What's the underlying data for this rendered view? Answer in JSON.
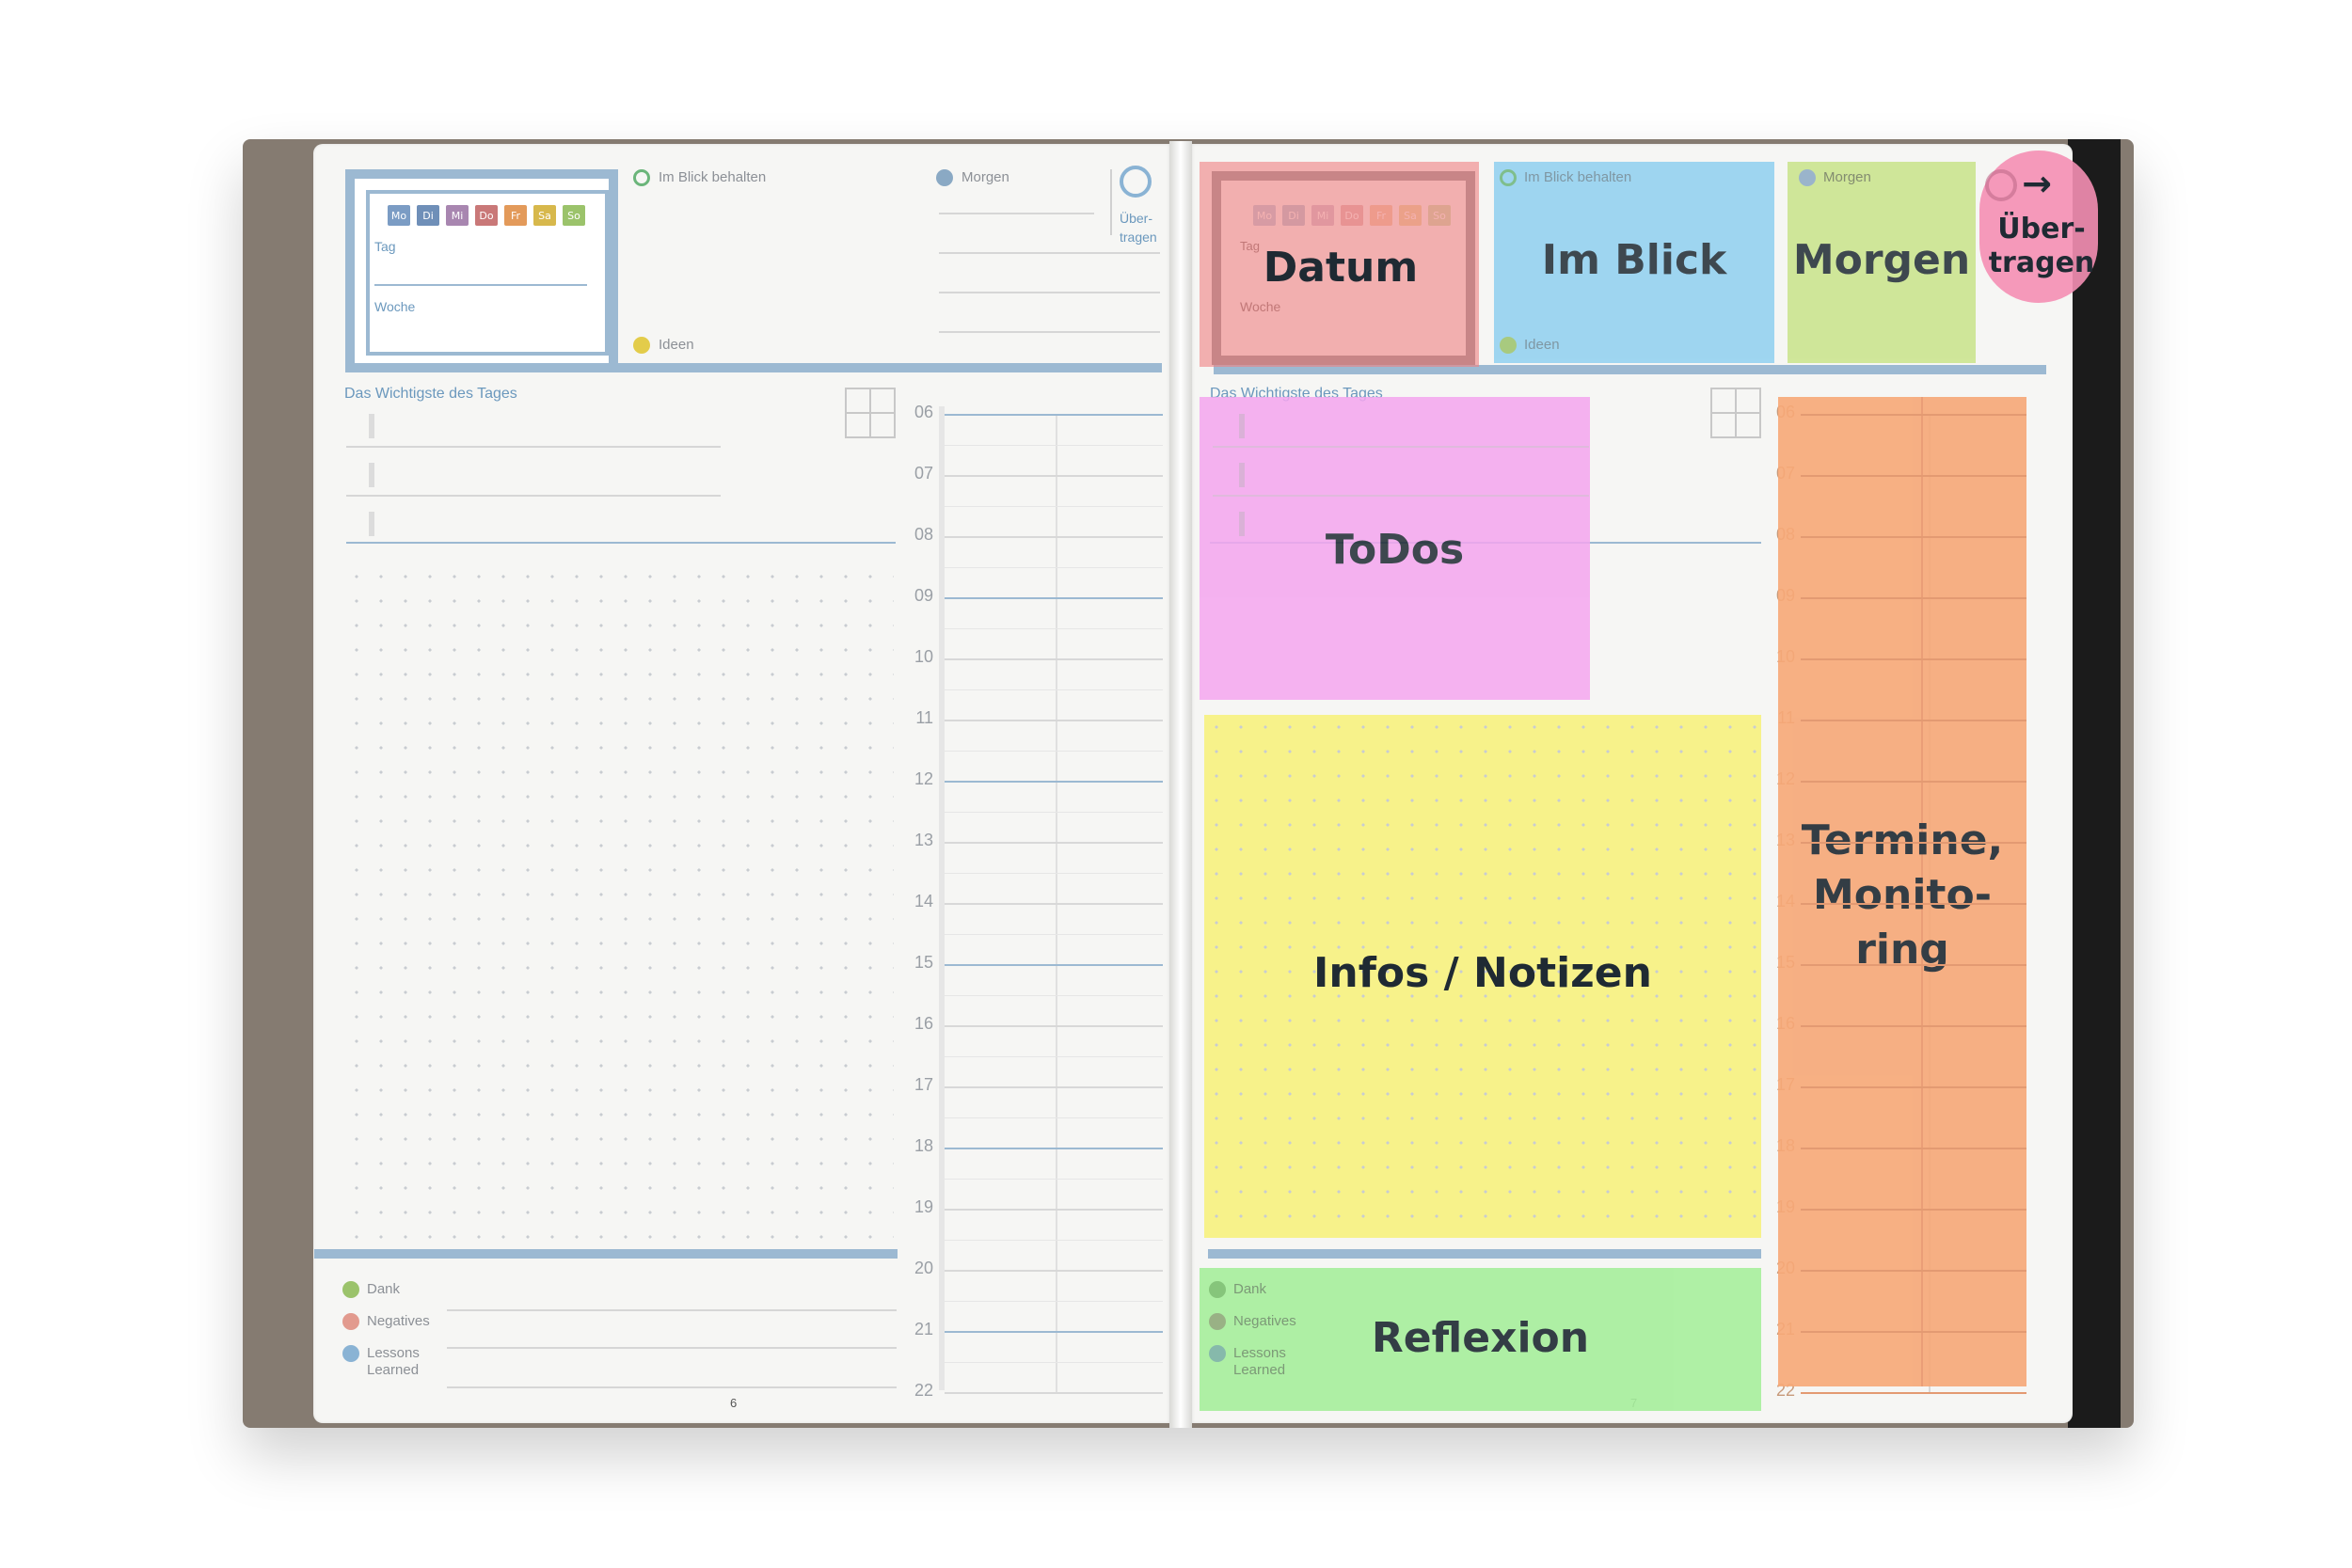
{
  "planner": {
    "days": [
      "Mo",
      "Di",
      "Mi",
      "Do",
      "Fr",
      "Sa",
      "So"
    ],
    "day_colors": [
      "#7b9cc4",
      "#6f8fb8",
      "#a886b0",
      "#c97878",
      "#e39a5a",
      "#d7b84c",
      "#9bc36b"
    ],
    "tag_label": "Tag",
    "woche_label": "Woche",
    "im_blick_label": "Im Blick behalten",
    "morgen_label": "Morgen",
    "uebertragen_label_1": "Über-",
    "uebertragen_label_2": "tragen",
    "ideen_label": "Ideen",
    "wichtigste_label": "Das Wichtigste des Tages",
    "hours": [
      "06",
      "07",
      "08",
      "09",
      "10",
      "11",
      "12",
      "13",
      "14",
      "15",
      "16",
      "17",
      "18",
      "19",
      "20",
      "21",
      "22"
    ],
    "dank_label": "Dank",
    "negatives_label": "Negatives",
    "lessons_label_1": "Lessons",
    "lessons_label_2": "Learned",
    "page_left": "6",
    "page_right": "7"
  },
  "overlays": {
    "datum": "Datum",
    "im_blick": "Im Blick",
    "morgen": "Morgen",
    "uebertragen_1": "Über-",
    "uebertragen_2": "tragen",
    "todos": "ToDos",
    "infos": "Infos / Notizen",
    "termine_1": "Termine,",
    "termine_2": "Monito-",
    "termine_3": "ring",
    "reflexion": "Reflexion"
  },
  "colors": {
    "datum": "#f08080",
    "im_blick": "#8fd0f0",
    "morgen": "#c9e48a",
    "uebertragen": "#f58fb4",
    "todos": "#f4a6ef",
    "infos": "#f7f28a",
    "termine": "#f7a877",
    "reflexion": "#a7ef9c"
  }
}
